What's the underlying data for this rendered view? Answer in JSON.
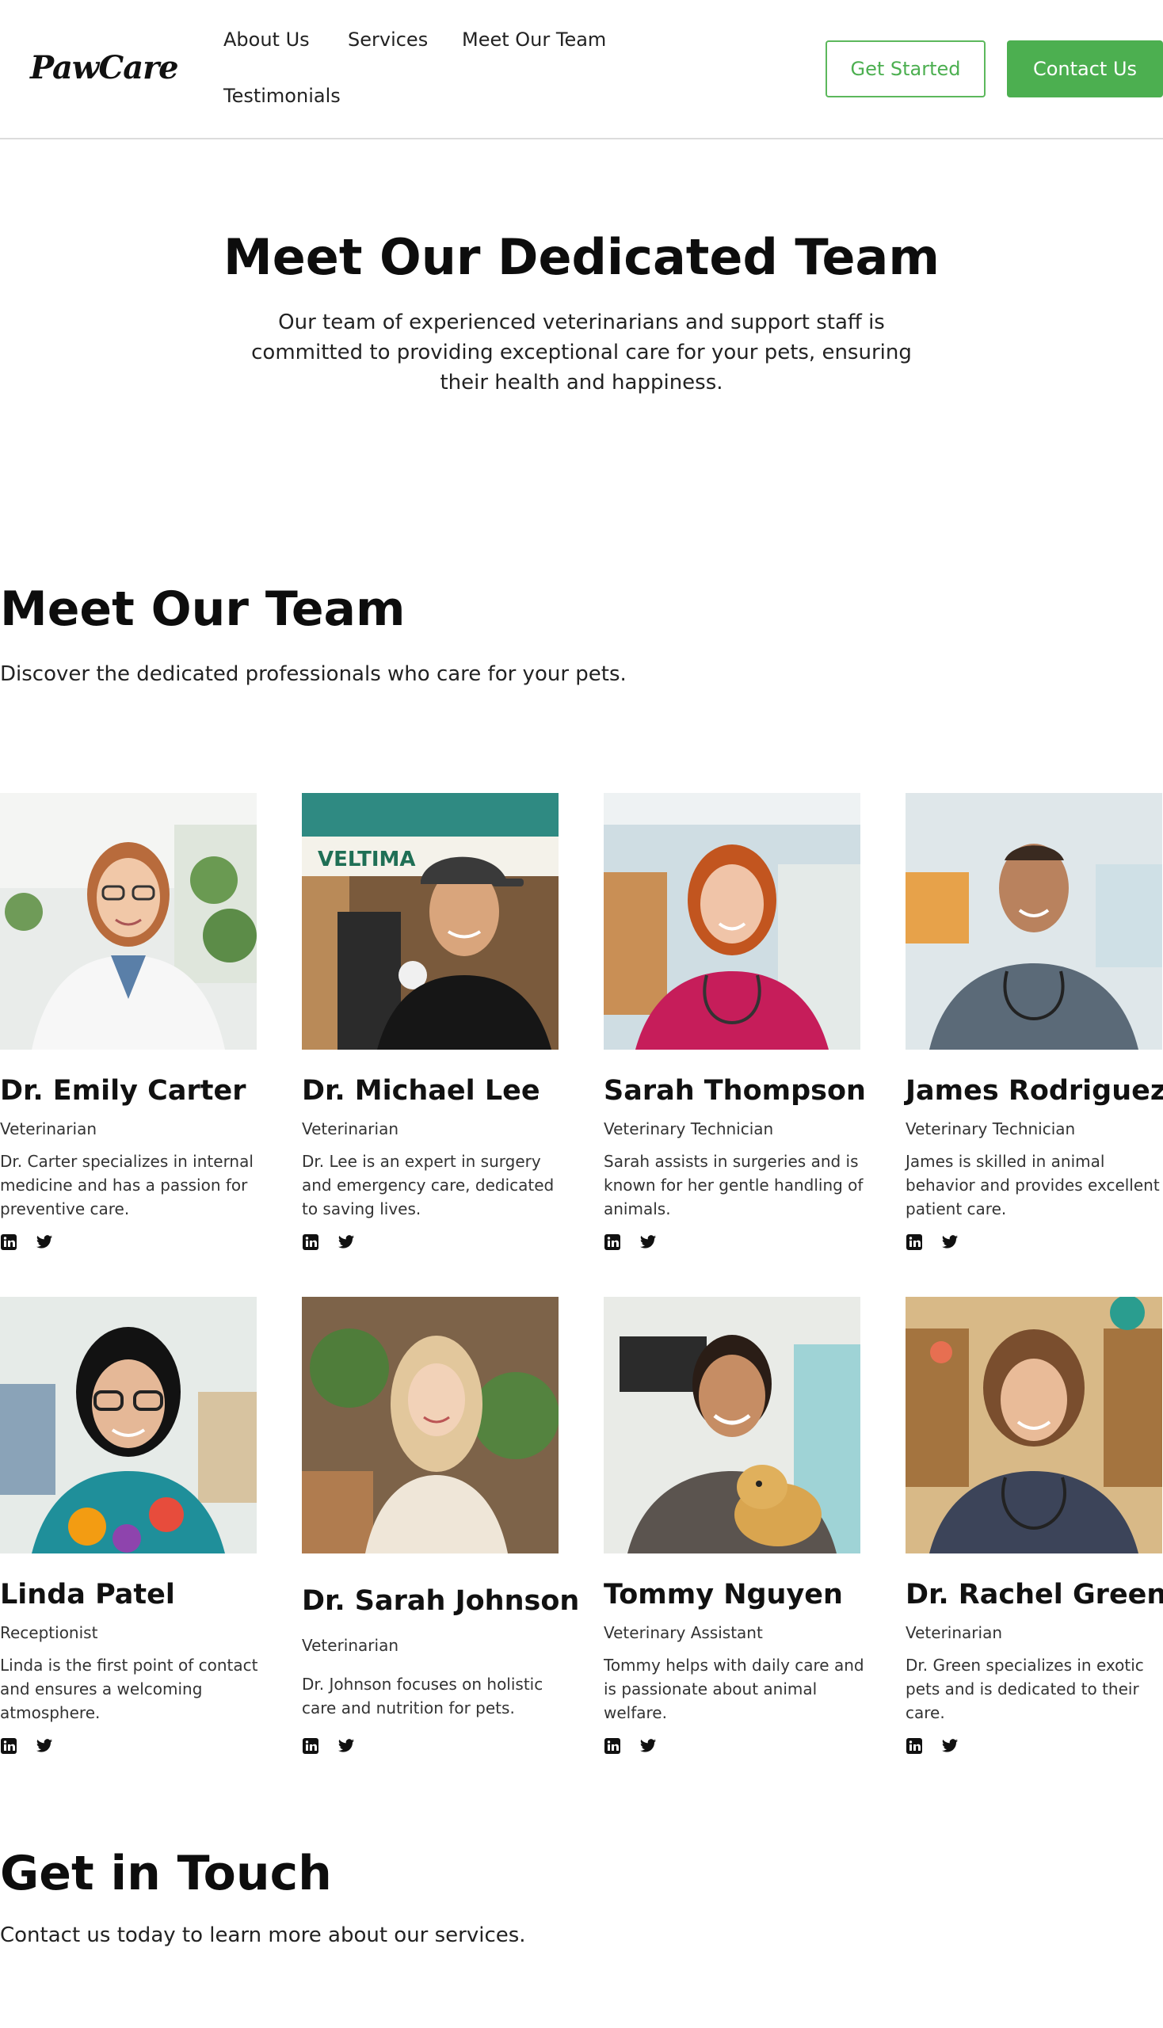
{
  "header": {
    "logo": "PawCare",
    "nav": [
      "About Us",
      "Services",
      "Meet Our Team",
      "Testimonials"
    ],
    "get_started": "Get Started",
    "contact_us": "Contact Us",
    "accent_color": "#4caf50"
  },
  "hero": {
    "title": "Meet Our Dedicated Team",
    "text": "Our team of experienced veterinarians and support staff is committed to providing exceptional care for your pets, ensuring their health and happiness."
  },
  "team": {
    "title": "Meet Our Team",
    "subtitle": "Discover the dedicated professionals who care for your pets.",
    "members": [
      {
        "name": "Dr. Emily Carter",
        "role": "Veterinarian",
        "desc": "Dr. Carter specializes in internal medicine and has a passion for preventive care."
      },
      {
        "name": "Dr. Michael Lee",
        "role": "Veterinarian",
        "desc": "Dr. Lee is an expert in surgery and emergency care, dedicated to saving lives."
      },
      {
        "name": "Sarah Thompson",
        "role": "Veterinary Technician",
        "desc": "Sarah assists in surgeries and is known for her gentle handling of animals."
      },
      {
        "name": "James Rodriguez",
        "role": "Veterinary Technician",
        "desc": "James is skilled in animal behavior and provides excellent patient care."
      },
      {
        "name": "Linda Patel",
        "role": "Receptionist",
        "desc": "Linda is the first point of contact and ensures a welcoming atmosphere."
      },
      {
        "name": "Dr. Sarah Johnson",
        "role": "Veterinarian",
        "desc": "Dr. Johnson focuses on holistic care and nutrition for pets."
      },
      {
        "name": "Tommy Nguyen",
        "role": "Veterinary Assistant",
        "desc": "Tommy helps with daily care and is passionate about animal welfare."
      },
      {
        "name": "Dr. Rachel Green",
        "role": "Veterinarian",
        "desc": "Dr. Green specializes in exotic pets and is dedicated to their care."
      }
    ]
  },
  "contact": {
    "title": "Get in Touch",
    "subtitle": "Contact us today to learn more about our services."
  }
}
